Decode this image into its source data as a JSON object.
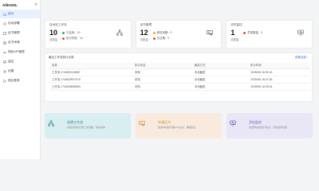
{
  "app": {
    "title": "AllinSSL",
    "collapse_icon": "menu-fold-icon"
  },
  "sidebar": {
    "items": [
      {
        "label": "首页",
        "icon": "home-icon",
        "active": true
      },
      {
        "label": "自动部署",
        "icon": "deploy-icon"
      },
      {
        "label": "证书管理",
        "icon": "certificate-icon"
      },
      {
        "label": "证书申请",
        "icon": "apply-icon"
      },
      {
        "label": "授权API管理",
        "icon": "api-icon"
      },
      {
        "label": "监控",
        "icon": "monitor-icon"
      },
      {
        "label": "设置",
        "icon": "settings-icon"
      },
      {
        "label": "退出登录",
        "icon": "logout-icon"
      }
    ]
  },
  "cards": [
    {
      "title": "自动化工作流",
      "count": "10",
      "unit": "总数量",
      "stats": [
        "已启用：10",
        "执行失败：10"
      ],
      "icon": "workflow-icon"
    },
    {
      "title": "证书管理",
      "count": "12",
      "unit": "总数量",
      "stats": [
        "即将到期：0",
        "已过期：0"
      ],
      "icon": "certificate-icon"
    },
    {
      "title": "实时监控",
      "count": "1",
      "unit": "总数量",
      "stats": [
        "异常数量：0"
      ],
      "icon": "monitor-icon"
    }
  ],
  "workflow_table": {
    "title": "最近工作流执行记录",
    "more_label": "查看全部 ›",
    "columns": [
      "名称",
      "执行状态",
      "触发方式",
      "执行时间"
    ],
    "rows": [
      [
        "工作流-1746529115887",
        "未知",
        "手动触发",
        "2025/5/6 18:09:16"
      ],
      [
        "工作流-1746529097076",
        "未知",
        "手动触发",
        "2025/5/6 18:07:53"
      ],
      [
        "工作流-1746528658984",
        "未知",
        "手动触发",
        "2025/5/6 18:06:44"
      ]
    ]
  },
  "quick_actions": [
    {
      "title": "创建工作流",
      "desc": "创建自动执行的工作流程，简化操作",
      "icon": "workflow-icon",
      "color": "#2b8b8f"
    },
    {
      "title": "申请证书",
      "desc": "快速申请和管理SSL证书，确保安全",
      "icon": "certificate-icon",
      "color": "#d18a3b"
    },
    {
      "title": "添加监控",
      "desc": "监控网站的运行状态，及时发现问题",
      "icon": "monitor-icon",
      "color": "#6b5fb8"
    }
  ],
  "colors": {
    "accent": "#3b6fd8",
    "success": "#27ae60",
    "danger": "#e74c3c",
    "warning": "#f5a623"
  }
}
